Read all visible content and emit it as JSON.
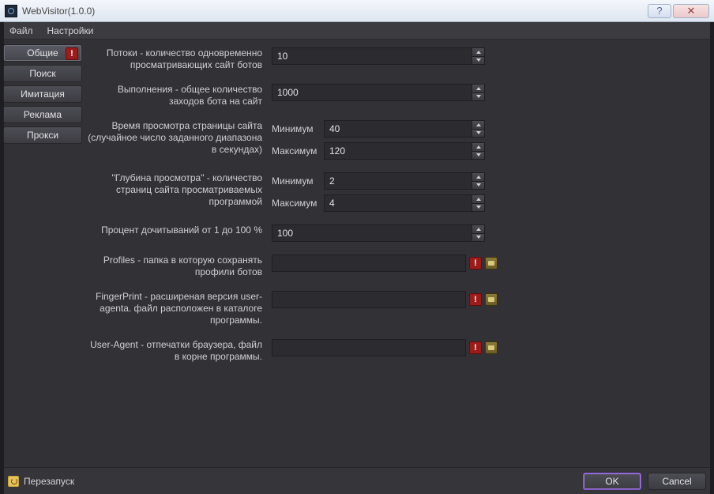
{
  "window": {
    "title": "WebVisitor(1.0.0)"
  },
  "menu": {
    "file": "Файл",
    "settings": "Настройки"
  },
  "sidebar": {
    "items": [
      {
        "label": "Общие",
        "active": true,
        "warn": true
      },
      {
        "label": "Поиск"
      },
      {
        "label": "Имитация"
      },
      {
        "label": "Реклама"
      },
      {
        "label": "Прокси"
      }
    ]
  },
  "labels": {
    "min": "Минимум",
    "max": "Максимум"
  },
  "form": {
    "threads": {
      "label": "Потоки - количество одновременно просматривающих сайт ботов",
      "value": "10"
    },
    "runs": {
      "label": "Выполнения - общее количество заходов бота на сайт",
      "value": "1000"
    },
    "view_time": {
      "label": "Время просмотра страницы сайта (случайное число заданного диапазона в секундах)",
      "min": "40",
      "max": "120"
    },
    "depth": {
      "label": "\"Глубина просмотра\" - количество страниц сайта просматриваемых программой",
      "min": "2",
      "max": "4"
    },
    "read_pct": {
      "label": "Процент дочитываний  от 1 до 100 %",
      "value": "100"
    },
    "profiles": {
      "label": "Profiles - папка в которую сохранять профили ботов",
      "value": ""
    },
    "fingerprint": {
      "label": "FingerPrint - расширеная версия user-agentа. файл расположен в каталоге программы.",
      "value": ""
    },
    "useragent": {
      "label": "User-Agent - отпечатки браузера, файл в корне программы.",
      "value": ""
    }
  },
  "footer": {
    "restart": "Перезапуск",
    "ok": "OK",
    "cancel": "Cancel"
  }
}
